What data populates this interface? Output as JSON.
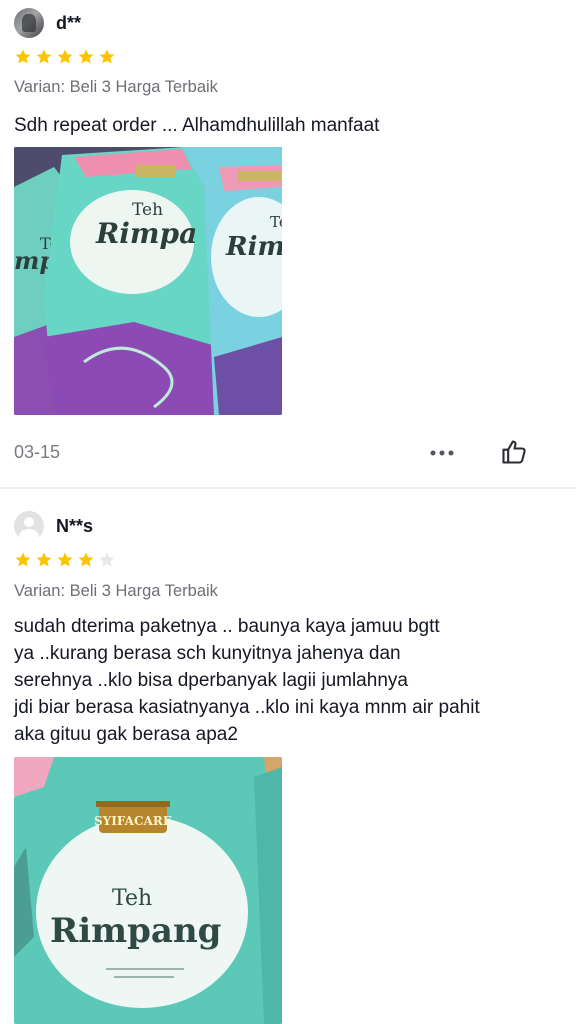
{
  "reviews": [
    {
      "username": "d**",
      "rating": 5,
      "max_rating": 5,
      "variant": "Varian: Beli 3 Harga Terbaik",
      "text": "Sdh repeat order ... Alhamdhulillah manfaat",
      "date": "03-15",
      "photo_labels": {
        "teh": "Teh",
        "rimpang": "Rimpa",
        "rimpang_2": "Rim",
        "side_left": "mp"
      }
    },
    {
      "username": "N**s",
      "rating": 4,
      "max_rating": 5,
      "variant": "Varian: Beli 3 Harga Terbaik",
      "text_lines": [
        "sudah dterima paketnya .. baunya kaya jamuu bgtt",
        "ya ..kurang berasa sch kunyitnya jahenya dan",
        "serehnya ..klo bisa dperbanyak lagii jumlahnya",
        "jdi biar berasa kasiatnyanya ..klo ini kaya mnm air pahit",
        "aka gituu gak berasa apa2"
      ],
      "photo_labels": {
        "brand": "SYIFACARE",
        "teh": "Teh",
        "rimpang": "Rimpang"
      }
    }
  ],
  "colors": {
    "star_filled": "#fdc500",
    "star_empty": "#e8e8ea",
    "text_secondary": "#6e6f76",
    "divider": "#f1f1f2"
  },
  "icons": {
    "more": "more-dots-icon",
    "like": "thumbs-up-icon",
    "star": "star-icon"
  }
}
